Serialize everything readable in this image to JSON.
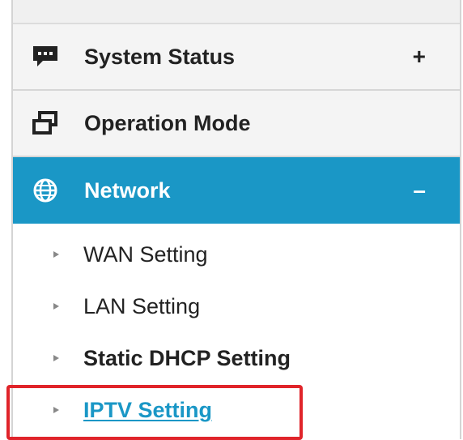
{
  "sidebar": {
    "sections": [
      {
        "label": "System Status",
        "toggle": "+",
        "icon": "chat-bubble-icon"
      },
      {
        "label": "Operation Mode",
        "icon": "windows-icon"
      },
      {
        "label": "Network",
        "toggle": "–",
        "icon": "globe-icon",
        "active": true
      }
    ],
    "network_items": [
      {
        "label": "WAN Setting"
      },
      {
        "label": "LAN Setting"
      },
      {
        "label": "Static DHCP Setting"
      },
      {
        "label": "IPTV Setting",
        "highlighted": true
      }
    ]
  },
  "colors": {
    "accent": "#1a97c6",
    "highlight": "#e0242a"
  }
}
